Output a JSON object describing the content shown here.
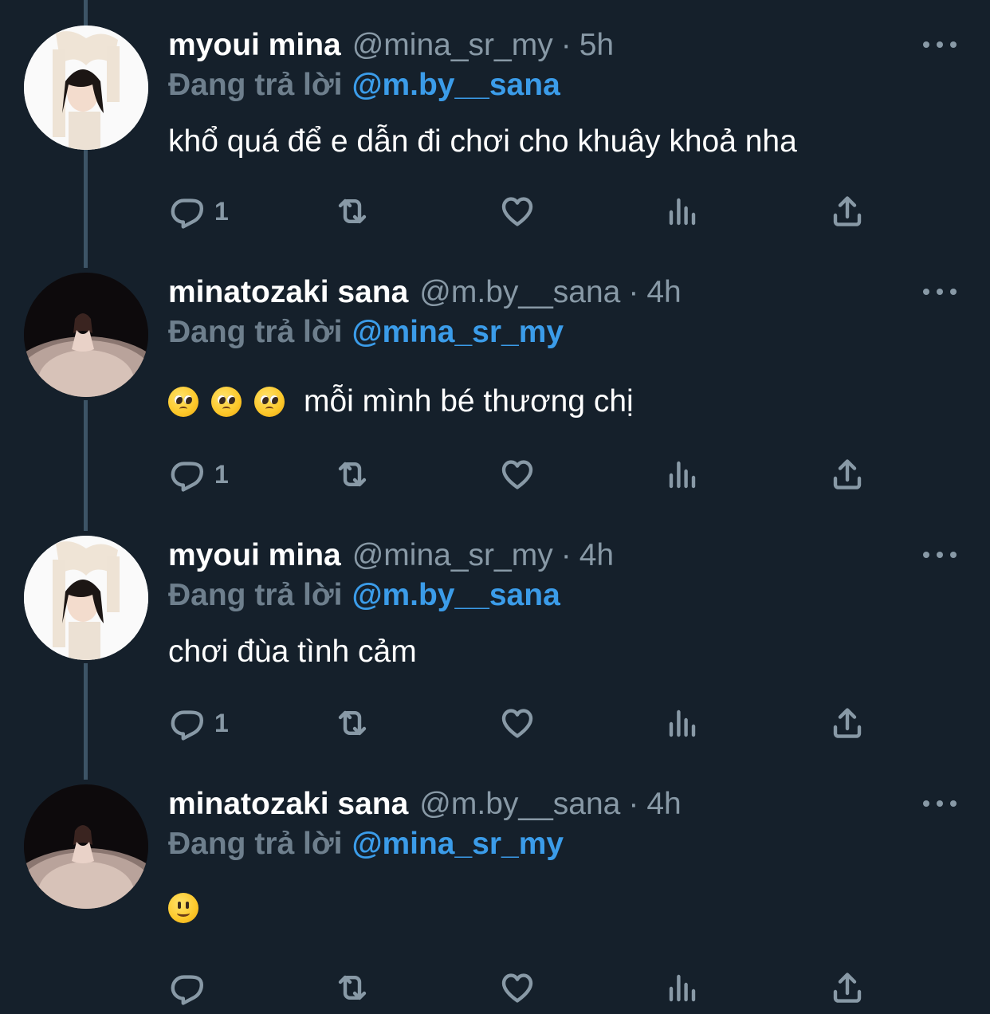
{
  "reply_prefix": "Đang trả lời",
  "tweets": [
    {
      "name": "myoui mina",
      "handle": "@mina_sr_my",
      "separator": "·",
      "time": "5h",
      "reply_to": "@m.by__sana",
      "text": "khổ quá để e dẫn đi chơi cho khuây khoả nha",
      "reply_count": "1",
      "avatar": "mina-avatar"
    },
    {
      "name": "minatozaki sana",
      "handle": "@m.by__sana",
      "separator": "·",
      "time": "4h",
      "reply_to": "@mina_sr_my",
      "emojis": [
        "pleading-face",
        "pleading-face",
        "pleading-face"
      ],
      "text": "mỗi mình bé thương chị",
      "reply_count": "1",
      "avatar": "sana-avatar"
    },
    {
      "name": "myoui mina",
      "handle": "@mina_sr_my",
      "separator": "·",
      "time": "4h",
      "reply_to": "@m.by__sana",
      "text": "chơi đùa tình cảm",
      "reply_count": "1",
      "avatar": "mina-avatar"
    },
    {
      "name": "minatozaki sana",
      "handle": "@m.by__sana",
      "separator": "·",
      "time": "4h",
      "reply_to": "@mina_sr_my",
      "emojis": [
        "slightly-smiling-face"
      ],
      "text": "",
      "reply_count": "",
      "avatar": "sana-avatar"
    }
  ],
  "colors": {
    "background": "#15202b",
    "secondary_text": "#8899a6",
    "link": "#3b9ce9",
    "thread_line": "#3d5466"
  },
  "icons": [
    "reply-icon",
    "retweet-icon",
    "like-icon",
    "analytics-icon",
    "share-icon",
    "more-icon"
  ]
}
